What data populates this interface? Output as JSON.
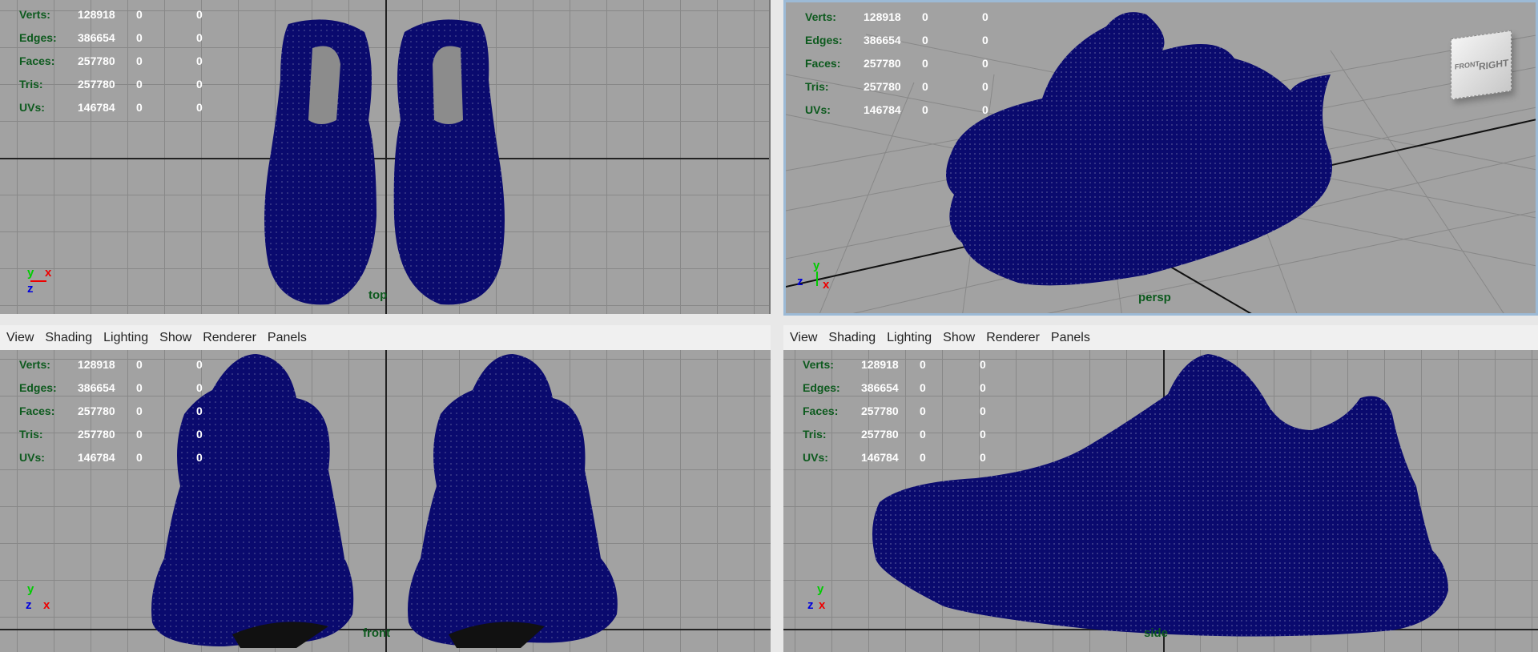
{
  "stats_labels": [
    "Verts:",
    "Edges:",
    "Faces:",
    "Tris:",
    "UVs:"
  ],
  "stats_values": [
    "128918",
    "386654",
    "257780",
    "257780",
    "146784"
  ],
  "stats_zero": "0",
  "menu": [
    "View",
    "Shading",
    "Lighting",
    "Show",
    "Renderer",
    "Panels"
  ],
  "panels": {
    "top": "top",
    "persp": "persp",
    "front": "front",
    "side": "side"
  },
  "view_cube": {
    "face_right": "RIGHT",
    "face_front": "FRONT"
  },
  "axes": {
    "x": "x",
    "y": "y",
    "z": "z"
  },
  "colors": {
    "mesh": "#0a0a6e",
    "label": "#0d5a1e",
    "active_border": "#9cbad6"
  }
}
